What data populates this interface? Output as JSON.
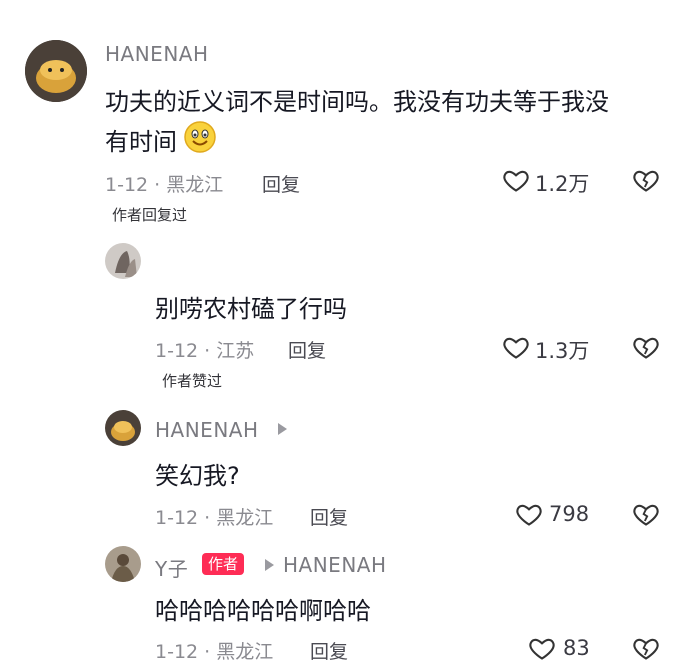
{
  "comments": [
    {
      "username": "HANENAH",
      "text_line1": "功夫的近义词不是时间吗。我没有功夫等于我没",
      "text_line2": "有时间",
      "emoji": "smiley-emoji",
      "date_region": "1-12 · 黑龙江",
      "reply_label": "回复",
      "likes": "1.2万",
      "author_tag": "作者回复过"
    },
    {
      "text": "别唠农村磕了行吗",
      "date_region": "1-12 · 江苏",
      "reply_label": "回复",
      "likes": "1.3万",
      "author_tag": "作者赞过"
    },
    {
      "username": "HANENAH",
      "text": "笑幻我?",
      "date_region": "1-12 · 黑龙江",
      "reply_label": "回复",
      "likes": "798"
    },
    {
      "username": "Y子",
      "badge": "作者",
      "reply_to": "HANENAH",
      "text": "哈哈哈哈哈哈啊哈哈",
      "date_region": "1-12 · 黑龙江",
      "reply_label": "回复",
      "likes": "83"
    }
  ],
  "colors": {
    "badge": "#fe2c55",
    "meta": "#8a8a90",
    "name": "#7a7a80"
  }
}
